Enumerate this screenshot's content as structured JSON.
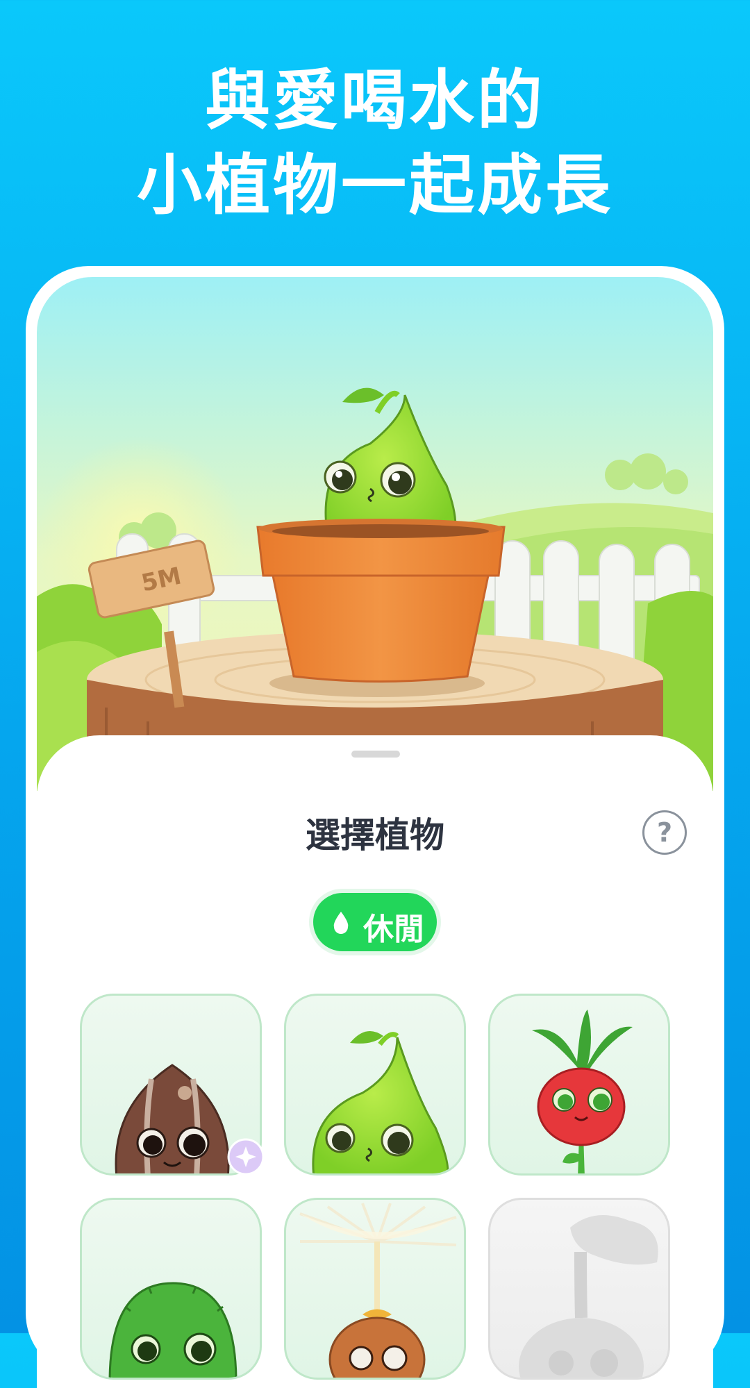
{
  "headline": {
    "line1": "與愛喝水的",
    "line2": "小植物一起成長"
  },
  "scene": {
    "sign_text": "5M"
  },
  "sheet": {
    "title": "選擇植物",
    "help_symbol": "?",
    "category_chip": {
      "label": "休閒",
      "icon": "water-drop-icon"
    }
  },
  "plants": [
    {
      "name": "seed",
      "locked": false,
      "badge": "sparkle-icon"
    },
    {
      "name": "sprout",
      "locked": false
    },
    {
      "name": "radish",
      "locked": false
    },
    {
      "name": "cactus",
      "locked": false
    },
    {
      "name": "dandelion",
      "locked": false
    },
    {
      "name": "mystery",
      "locked": true
    }
  ],
  "colors": {
    "accent_green": "#22d65a",
    "background_blue": "#05a6ee",
    "pot_orange": "#ef8a33"
  }
}
